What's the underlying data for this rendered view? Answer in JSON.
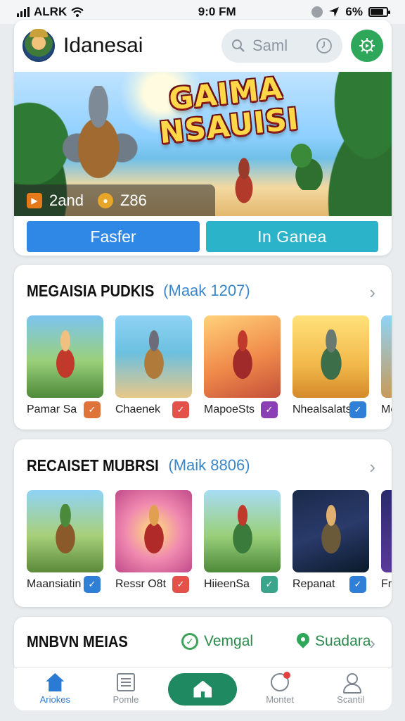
{
  "status_bar": {
    "carrier": "ALRK",
    "time": "9:0 FM",
    "battery_percent": "6%"
  },
  "header": {
    "title": "Idanesai",
    "search_placeholder": "Saml",
    "avatar_icon": "warrior-avatar",
    "action_icon": "settings-icon"
  },
  "banner": {
    "title_line1": "GAIMA",
    "title_line2": "NSAUISI",
    "stat1": "2and",
    "stat2": "Z86"
  },
  "buttons": {
    "primary": "Fasfer",
    "secondary": "In Ganea"
  },
  "section1": {
    "title": "MEGAISIA PUDKIS",
    "subtitle": "(Maak 1207)",
    "items": [
      {
        "label": "Pamar Sa",
        "badge_color": "#e0733a"
      },
      {
        "label": "Chaenek",
        "badge_color": "#e3514a"
      },
      {
        "label": "MapoeSts",
        "badge_color": "#8a3fb5"
      },
      {
        "label": "Nhealsalats",
        "badge_color": "#2f7fd6"
      },
      {
        "label": "Me",
        "badge_color": "#2f7fd6"
      }
    ]
  },
  "section2": {
    "title": "RECAISET MUBRSI",
    "subtitle": "(Maik 8806)",
    "items": [
      {
        "label": "Maansiatin",
        "badge_color": "#2f7fd6"
      },
      {
        "label": "Ressr O8t",
        "badge_color": "#e3514a"
      },
      {
        "label": "HiieenSa",
        "badge_color": "#3aa58a"
      },
      {
        "label": "Repanat",
        "badge_color": "#2f7fd6"
      },
      {
        "label": "Fri",
        "badge_color": "#2f7fd6"
      }
    ]
  },
  "section3": {
    "title": "MNBVN MEIAS",
    "tag1": "Vemgal",
    "tag2": "Suadara"
  },
  "nav": [
    {
      "label": "Ariokes",
      "icon": "home-icon",
      "active": true
    },
    {
      "label": "Pomle",
      "icon": "list-icon"
    },
    {
      "label": "",
      "icon": "center-home-icon"
    },
    {
      "label": "Montet",
      "icon": "notification-icon"
    },
    {
      "label": "Scantil",
      "icon": "user-icon"
    }
  ]
}
